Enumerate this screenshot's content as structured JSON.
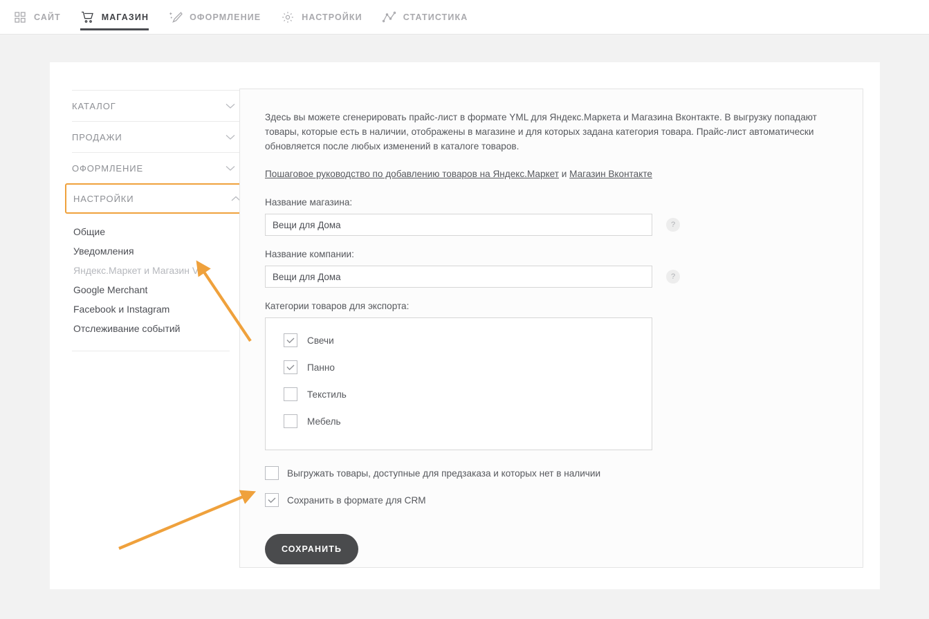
{
  "topnav": {
    "items": [
      {
        "label": "САЙТ",
        "icon": "grid-icon",
        "active": false
      },
      {
        "label": "МАГАЗИН",
        "icon": "cart-icon",
        "active": true
      },
      {
        "label": "ОФОРМЛЕНИЕ",
        "icon": "magic-brush-icon",
        "active": false
      },
      {
        "label": "НАСТРОЙКИ",
        "icon": "gear-icon",
        "active": false
      },
      {
        "label": "СТАТИСТИКА",
        "icon": "chart-line-icon",
        "active": false
      }
    ]
  },
  "sidebar": {
    "groups": [
      {
        "label": "КАТАЛОГ",
        "icon": "chevron-down-icon",
        "expanded": false,
        "highlighted": false
      },
      {
        "label": "ПРОДАЖИ",
        "icon": "chevron-down-icon",
        "expanded": false,
        "highlighted": false
      },
      {
        "label": "ОФОРМЛЕНИЕ",
        "icon": "chevron-down-icon",
        "expanded": false,
        "highlighted": false
      },
      {
        "label": "НАСТРОЙКИ",
        "icon": "chevron-up-icon",
        "expanded": true,
        "highlighted": true
      }
    ],
    "sub_items": [
      {
        "label": "Общие",
        "selected": false
      },
      {
        "label": "Уведомления",
        "selected": false
      },
      {
        "label": "Яндекс.Маркет и Магазин VK",
        "selected": true
      },
      {
        "label": "Google Merchant",
        "selected": false
      },
      {
        "label": "Facebook и Instagram",
        "selected": false
      },
      {
        "label": "Отслеживание событий",
        "selected": false
      }
    ]
  },
  "main": {
    "description": "Здесь вы можете сгенерировать прайс-лист в формате YML для Яндекс.Маркета и Магазина Вконтакте. В выгрузку попадают товары, которые есть в наличии, отображены в магазине и для которых задана категория товара. Прайс-лист автоматически обновляется после любых изменений в каталоге товаров.",
    "guide_link_1": "Пошаговое руководство по добавлению товаров на Яндекс.Маркет",
    "guide_conjunction": " и ",
    "guide_link_2": "Магазин Вконтакте",
    "shop_name_label": "Название магазина:",
    "shop_name_value": "Вещи для Дома",
    "shop_name_placeholder": "Название магазина",
    "company_name_label": "Название компании:",
    "company_name_value": "Вещи для Дома",
    "company_name_placeholder": "Название компании",
    "help_glyph": "?",
    "categories_label": "Категории товаров для экспорта:",
    "categories": [
      {
        "label": "Свечи",
        "checked": true
      },
      {
        "label": "Панно",
        "checked": true
      },
      {
        "label": "Текстиль",
        "checked": false
      },
      {
        "label": "Мебель",
        "checked": false
      }
    ],
    "options": [
      {
        "label": "Выгружать товары, доступные для предзаказа и которых нет в наличии",
        "checked": false
      },
      {
        "label": "Сохранить в формате для CRM",
        "checked": true
      }
    ],
    "save_label": "СОХРАНИТЬ"
  },
  "annotations": {
    "accent_color": "#efa13c",
    "arrow_1_target": "Яндекс.Маркет и Магазин VK",
    "arrow_2_target": "Сохранить в формате для CRM"
  },
  "colors": {
    "page_bg": "#f2f2f2",
    "card_bg": "#ffffff",
    "panel_bg": "#fcfcfc",
    "text": "#56585d",
    "muted": "#b6b8bd",
    "accent": "#efa13c",
    "button_bg": "#4a4b4d"
  }
}
